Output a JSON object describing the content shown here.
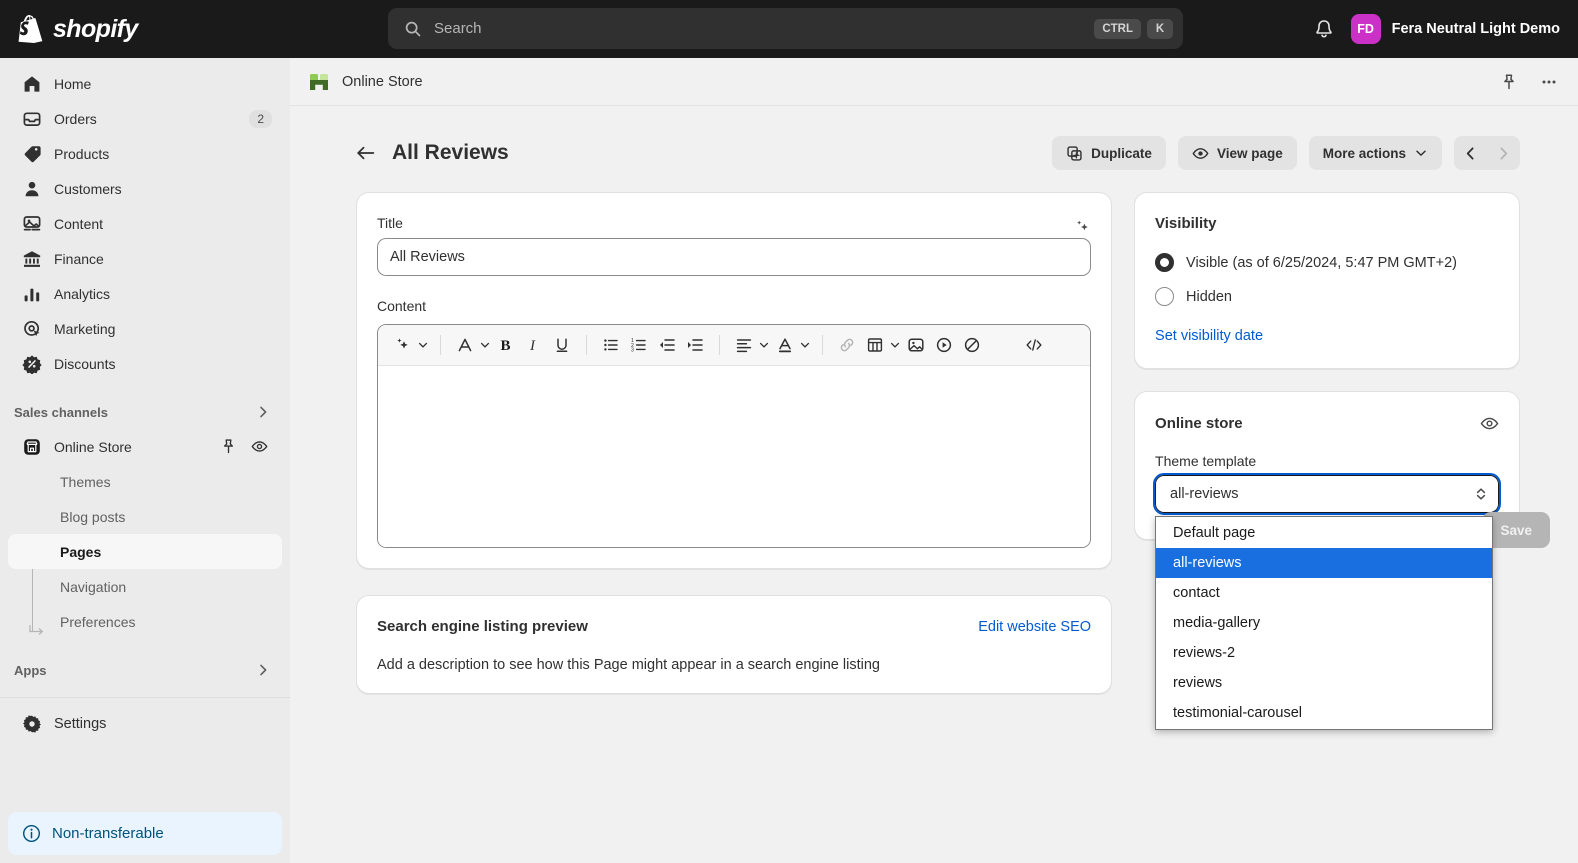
{
  "topbar": {
    "brand": "shopify",
    "search": {
      "placeholder": "Search",
      "kbd_ctrl": "CTRL",
      "kbd_k": "K"
    },
    "account": {
      "initials": "FD",
      "name": "Fera Neutral Light Demo"
    }
  },
  "sidebar": {
    "items": [
      {
        "label": "Home",
        "icon": "home-icon",
        "badge": ""
      },
      {
        "label": "Orders",
        "icon": "orders-icon",
        "badge": "2"
      },
      {
        "label": "Products",
        "icon": "products-icon",
        "badge": ""
      },
      {
        "label": "Customers",
        "icon": "customers-icon",
        "badge": ""
      },
      {
        "label": "Content",
        "icon": "content-icon",
        "badge": ""
      },
      {
        "label": "Finance",
        "icon": "finance-icon",
        "badge": ""
      },
      {
        "label": "Analytics",
        "icon": "analytics-icon",
        "badge": ""
      },
      {
        "label": "Marketing",
        "icon": "marketing-icon",
        "badge": ""
      },
      {
        "label": "Discounts",
        "icon": "discounts-icon",
        "badge": ""
      }
    ],
    "sales_channels_label": "Sales channels",
    "online_store": {
      "label": "Online Store",
      "icon": "storefront-icon"
    },
    "sub_items": [
      {
        "label": "Themes",
        "active": false
      },
      {
        "label": "Blog posts",
        "active": false
      },
      {
        "label": "Pages",
        "active": true
      },
      {
        "label": "Navigation",
        "active": false
      },
      {
        "label": "Preferences",
        "active": false
      }
    ],
    "apps_label": "Apps",
    "settings_label": "Settings",
    "non_transferable_label": "Non-transferable"
  },
  "breadcrumb": {
    "label": "Online Store"
  },
  "page": {
    "title": "All Reviews",
    "actions": {
      "duplicate": "Duplicate",
      "view_page": "View page",
      "more_actions": "More actions"
    },
    "save_label": "Save"
  },
  "title_card": {
    "label": "Title",
    "value": "All Reviews",
    "placeholder": "",
    "content_label": "Content",
    "toolbar": [
      "magic-icon",
      "font-size-icon",
      "bold-icon",
      "italic-icon",
      "underline-icon",
      "bulleted-list-icon",
      "numbered-list-icon",
      "outdent-icon",
      "indent-icon",
      "align-icon",
      "text-color-icon",
      "link-icon",
      "table-icon",
      "image-icon",
      "video-icon",
      "no-content-icon",
      "code-icon"
    ],
    "body": ""
  },
  "seo_card": {
    "title": "Search engine listing preview",
    "edit_link": "Edit website SEO",
    "body": "Add a description to see how this Page might appear in a search engine listing"
  },
  "visibility_card": {
    "title": "Visibility",
    "options": [
      {
        "label": "Visible (as of 6/25/2024, 5:47 PM GMT+2)",
        "selected": true
      },
      {
        "label": "Hidden",
        "selected": false
      }
    ],
    "set_date_link": "Set visibility date"
  },
  "online_store_card": {
    "title": "Online store",
    "theme_template_label": "Theme template",
    "selected_template": "all-reviews",
    "options": [
      {
        "label": "Default page",
        "selected": false
      },
      {
        "label": "all-reviews",
        "selected": true
      },
      {
        "label": "contact",
        "selected": false
      },
      {
        "label": "media-gallery",
        "selected": false
      },
      {
        "label": "reviews-2",
        "selected": false
      },
      {
        "label": "reviews",
        "selected": false
      },
      {
        "label": "testimonial-carousel",
        "selected": false
      }
    ]
  },
  "colors": {
    "topbar_bg": "#1a1a1a",
    "sidebar_bg": "#ebebeb",
    "accent_link": "#005bd3",
    "dropdown_selected": "#1a6fe0",
    "avatar_bg": "#cc31c7",
    "badge_info_bg": "#eaf4ff"
  }
}
